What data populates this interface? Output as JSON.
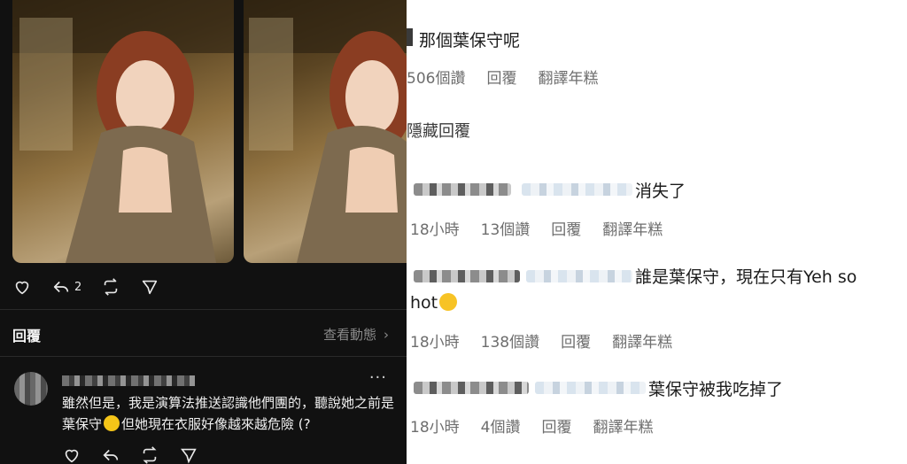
{
  "left_post": {
    "actions": {
      "reply_count": "2"
    },
    "reply_header": "回覆",
    "view_activity": "查看動態",
    "comment": {
      "more": "···",
      "text": "雖然但是，我是演算法推送認識他們團的，聽說她之前是葉保守",
      "text_after_emoji": "但她現在衣服好像越來越危險 (?"
    }
  },
  "right_thread": {
    "top_comment": {
      "text": "那個葉保守呢",
      "meta": [
        "506個讚",
        "回覆",
        "翻譯年糕"
      ]
    },
    "hide_replies": "隱藏回覆",
    "replies": [
      {
        "text": "消失了",
        "meta": [
          "18小時",
          "13個讚",
          "回覆",
          "翻譯年糕"
        ]
      },
      {
        "text": "誰是葉保守，現在只有Yeh so",
        "text_line2": "hot",
        "meta": [
          "18小時",
          "138個讚",
          "回覆",
          "翻譯年糕"
        ]
      },
      {
        "text": "葉保守被我吃掉了",
        "meta": [
          "18小時",
          "4個讚",
          "回覆",
          "翻譯年糕"
        ]
      }
    ]
  },
  "colors": {
    "dark_bg": "#111111",
    "light_bg": "#ffffff",
    "meta_gray": "#6e6e6e"
  }
}
